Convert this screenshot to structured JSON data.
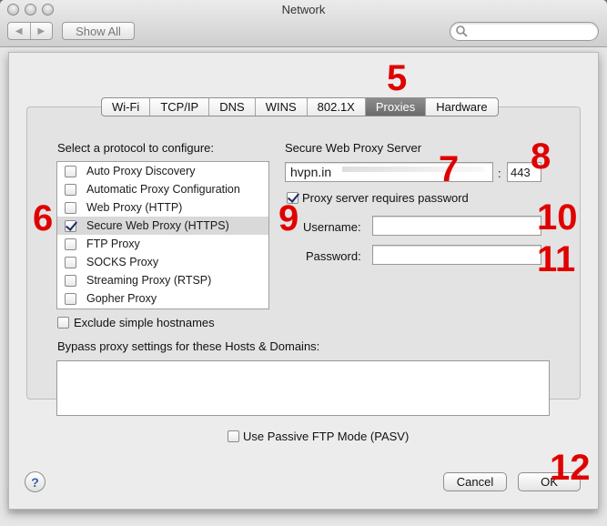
{
  "window": {
    "title": "Network",
    "show_all_label": "Show All",
    "nav_back_icon": "chevron-left-icon",
    "nav_forward_icon": "chevron-right-icon",
    "search_icon": "search-icon"
  },
  "tabs": {
    "items": [
      "Wi-Fi",
      "TCP/IP",
      "DNS",
      "WINS",
      "802.1X",
      "Proxies",
      "Hardware"
    ],
    "active": "Proxies"
  },
  "protocols": {
    "heading": "Select a protocol to configure:",
    "items": [
      {
        "label": "Auto Proxy Discovery",
        "checked": false
      },
      {
        "label": "Automatic Proxy Configuration",
        "checked": false
      },
      {
        "label": "Web Proxy (HTTP)",
        "checked": false
      },
      {
        "label": "Secure Web Proxy (HTTPS)",
        "checked": true,
        "selected": true
      },
      {
        "label": "FTP Proxy",
        "checked": false
      },
      {
        "label": "SOCKS Proxy",
        "checked": false
      },
      {
        "label": "Streaming Proxy (RTSP)",
        "checked": false
      },
      {
        "label": "Gopher Proxy",
        "checked": false
      }
    ]
  },
  "exclude_simple_hostnames": {
    "label": "Exclude simple hostnames",
    "checked": false
  },
  "server": {
    "heading": "Secure Web Proxy Server",
    "host_value": "hvpn.in",
    "separator": ":",
    "port_value": "443",
    "requires_password_label": "Proxy server requires password",
    "requires_password_checked": true,
    "username_label": "Username:",
    "username_value": "",
    "password_label": "Password:",
    "password_value": ""
  },
  "bypass": {
    "label": "Bypass proxy settings for these Hosts & Domains:",
    "value": ""
  },
  "passive_ftp": {
    "label": "Use Passive FTP Mode (PASV)",
    "checked": false
  },
  "buttons": {
    "help_label": "?",
    "cancel_label": "Cancel",
    "ok_label": "OK"
  },
  "annotations": [
    "5",
    "6",
    "7",
    "8",
    "9",
    "10",
    "11",
    "12"
  ],
  "colors": {
    "annotation": "#e00000",
    "active_tab": "#7a7a7a",
    "checkmark": "#1d2b6a",
    "help_icon": "#2d5fa8"
  }
}
